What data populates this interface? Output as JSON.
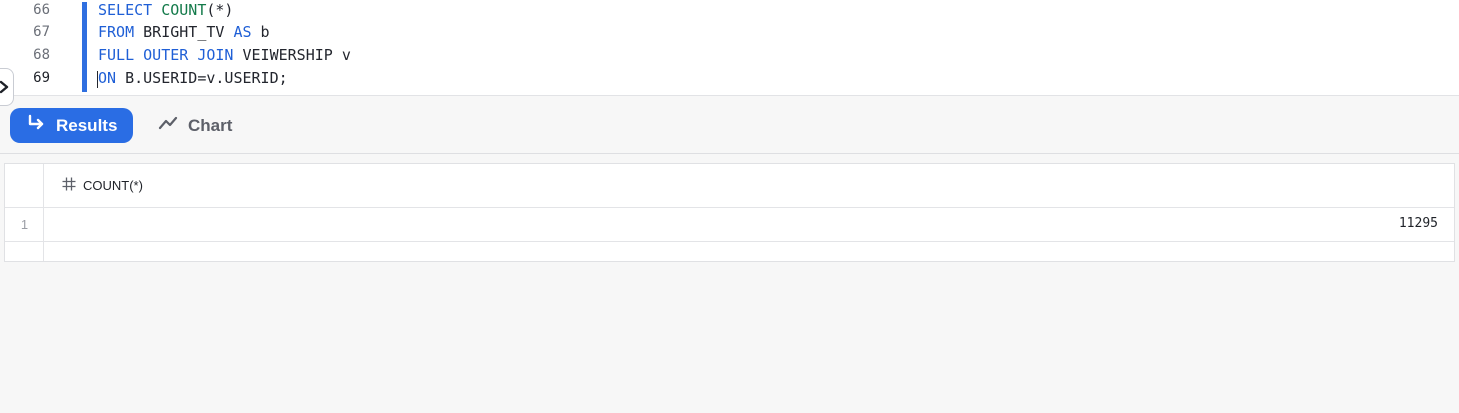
{
  "editor": {
    "lines": [
      {
        "number": "66",
        "tokens": [
          {
            "text": "SELECT",
            "kind": "kw"
          },
          {
            "text": " ",
            "kind": "id"
          },
          {
            "text": "COUNT",
            "kind": "fn"
          },
          {
            "text": "(*)",
            "kind": "id"
          }
        ]
      },
      {
        "number": "67",
        "tokens": [
          {
            "text": "FROM",
            "kind": "kw"
          },
          {
            "text": " BRIGHT_TV ",
            "kind": "id"
          },
          {
            "text": "AS",
            "kind": "kw"
          },
          {
            "text": " b",
            "kind": "id"
          }
        ]
      },
      {
        "number": "68",
        "tokens": [
          {
            "text": "FULL",
            "kind": "kw"
          },
          {
            "text": " ",
            "kind": "id"
          },
          {
            "text": "OUTER",
            "kind": "kw"
          },
          {
            "text": " ",
            "kind": "id"
          },
          {
            "text": "JOIN",
            "kind": "kw"
          },
          {
            "text": " VEIWERSHIP v",
            "kind": "id"
          }
        ]
      },
      {
        "number": "69",
        "tokens": [
          {
            "text": "ON",
            "kind": "kw"
          },
          {
            "text": " B.USERID=v.USERID;",
            "kind": "id"
          }
        ]
      }
    ],
    "active_line": "69"
  },
  "toolbar": {
    "results_label": "Results",
    "chart_label": "Chart",
    "active_tab": "results"
  },
  "results": {
    "columns": [
      {
        "name": "COUNT(*)",
        "type_icon": "hash-icon"
      }
    ],
    "rows": [
      {
        "index": "1",
        "values": [
          "11295"
        ]
      }
    ]
  },
  "colors": {
    "accent": "#2a6de4",
    "keyword": "#1f5fd6",
    "function": "#137a4a"
  },
  "icons": {
    "collapse_handle": "chevron-right-icon",
    "results_tab": "return-arrow-icon",
    "chart_tab": "trend-line-icon"
  }
}
